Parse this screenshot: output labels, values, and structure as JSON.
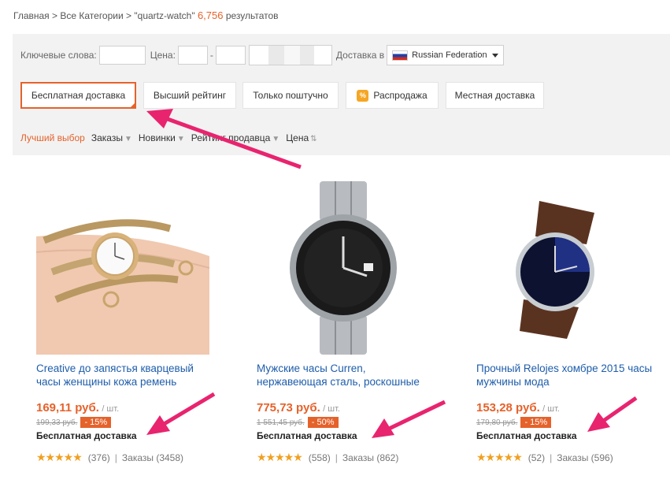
{
  "breadcrumb": {
    "home": "Главная",
    "sep": " > ",
    "categories": "Все Категории",
    "query": "\"quartz-watch\"",
    "count": "6,756",
    "results": "результатов"
  },
  "filters": {
    "keywords_label": "Ключевые слова:",
    "price_label": "Цена:",
    "price_dash": "-",
    "shipping_label": "Доставка в",
    "shipping_country": "Russian Federation"
  },
  "filter_buttons": [
    "Бесплатная доставка",
    "Высший рейтинг",
    "Только поштучно",
    "Распродажа",
    "Местная доставка"
  ],
  "sale_icon_glyph": "%",
  "sort": [
    "Лучший выбор",
    "Заказы",
    "Новинки",
    "Рейтинг продавца",
    "Цена"
  ],
  "products": [
    {
      "title": "Creative до запястья кварцевый часы женщины кожа ремень",
      "price": "169,11 руб.",
      "unit": "/ шт.",
      "old_price": "199,33 руб.",
      "discount": "- 15%",
      "shipping": "Бесплатная доставка",
      "stars": "★★★★★",
      "reviews": "(376)",
      "orders": "Заказы (3458)"
    },
    {
      "title": "Мужские часы Curren, нержавеющая сталь, роскошные",
      "price": "775,73 руб.",
      "unit": "/ шт.",
      "old_price": "1 551,45 руб.",
      "discount": "- 50%",
      "shipping": "Бесплатная доставка",
      "stars": "★★★★★",
      "reviews": "(558)",
      "orders": "Заказы (862)"
    },
    {
      "title": "Прочный Relojes хомбре 2015 часы мужчины мода",
      "price": "153,28 руб.",
      "unit": "/ шт.",
      "old_price": "179,80 руб.",
      "discount": "- 15%",
      "shipping": "Бесплатная доставка",
      "stars": "★★★★★",
      "reviews": "(52)",
      "orders": "Заказы (596)"
    }
  ],
  "colors": {
    "accent": "#e5622b",
    "link": "#1e5dab",
    "annotation_arrow": "#e8246f",
    "star": "#f0a020"
  }
}
